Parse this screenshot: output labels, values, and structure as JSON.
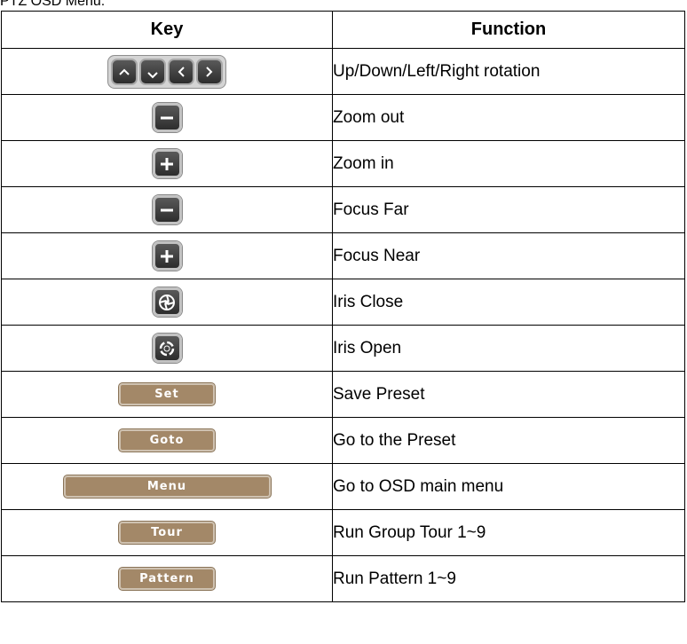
{
  "caption": "PTZ OSD Menu:",
  "table": {
    "headers": {
      "key": "Key",
      "function": "Function"
    },
    "rows": [
      {
        "key": {
          "type": "arrows",
          "icons": [
            "up-arrow-icon",
            "down-arrow-icon",
            "left-arrow-icon",
            "right-arrow-icon"
          ]
        },
        "function": "Up/Down/Left/Right rotation"
      },
      {
        "key": {
          "type": "icon",
          "icon": "minus-icon"
        },
        "function": "Zoom out"
      },
      {
        "key": {
          "type": "icon",
          "icon": "plus-icon"
        },
        "function": "Zoom in"
      },
      {
        "key": {
          "type": "icon",
          "icon": "minus-icon"
        },
        "function": "Focus Far"
      },
      {
        "key": {
          "type": "icon",
          "icon": "plus-icon"
        },
        "function": "Focus Near"
      },
      {
        "key": {
          "type": "icon",
          "icon": "iris-close-icon"
        },
        "function": "Iris Close"
      },
      {
        "key": {
          "type": "icon",
          "icon": "iris-open-icon"
        },
        "function": "Iris Open"
      },
      {
        "key": {
          "type": "button",
          "label": "Set"
        },
        "function": "Save Preset"
      },
      {
        "key": {
          "type": "button",
          "label": "Goto"
        },
        "function": "Go to the Preset"
      },
      {
        "key": {
          "type": "button",
          "label": "Menu"
        },
        "function": "Go to OSD main menu"
      },
      {
        "key": {
          "type": "button",
          "label": "Tour"
        },
        "function": "Run Group Tour 1~9"
      },
      {
        "key": {
          "type": "button",
          "label": "Pattern"
        },
        "function": "Run Pattern 1~9"
      }
    ]
  },
  "colors": {
    "key_dark": "#3a3a3a",
    "key_brown": "#a38868",
    "border": "#000000"
  }
}
